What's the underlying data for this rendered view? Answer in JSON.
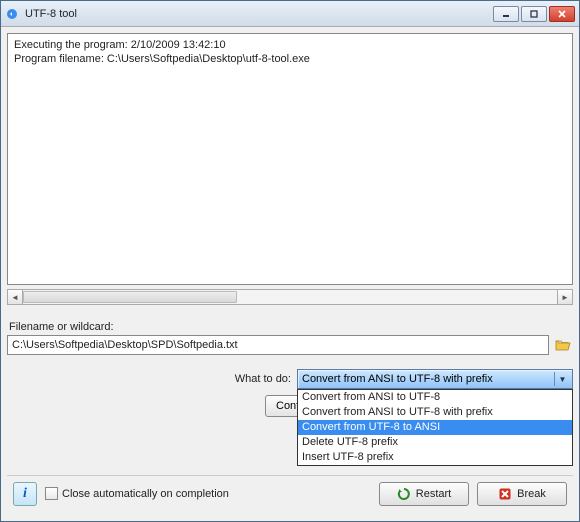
{
  "window": {
    "title": "UTF-8 tool"
  },
  "log": {
    "line1": "Executing the program:  2/10/2009 13:42:10",
    "line2": "Program filename: C:\\Users\\Softpedia\\Desktop\\utf-8-tool.exe"
  },
  "filename": {
    "label": "Filename or wildcard:",
    "value": "C:\\Users\\Softpedia\\Desktop\\SPD\\Softpedia.txt"
  },
  "whattodo": {
    "label": "What to do:",
    "selected": "Convert from ANSI to UTF-8 with prefix",
    "options": [
      "Convert from ANSI to UTF-8",
      "Convert from ANSI to UTF-8 with prefix",
      "Convert from UTF-8 to ANSI",
      "Delete UTF-8 prefix",
      "Insert UTF-8 prefix"
    ]
  },
  "buttons": {
    "continue": "Contin",
    "restart": "Restart",
    "break": "Break"
  },
  "checkbox": {
    "close_on_completion": "Close automatically on completion"
  }
}
